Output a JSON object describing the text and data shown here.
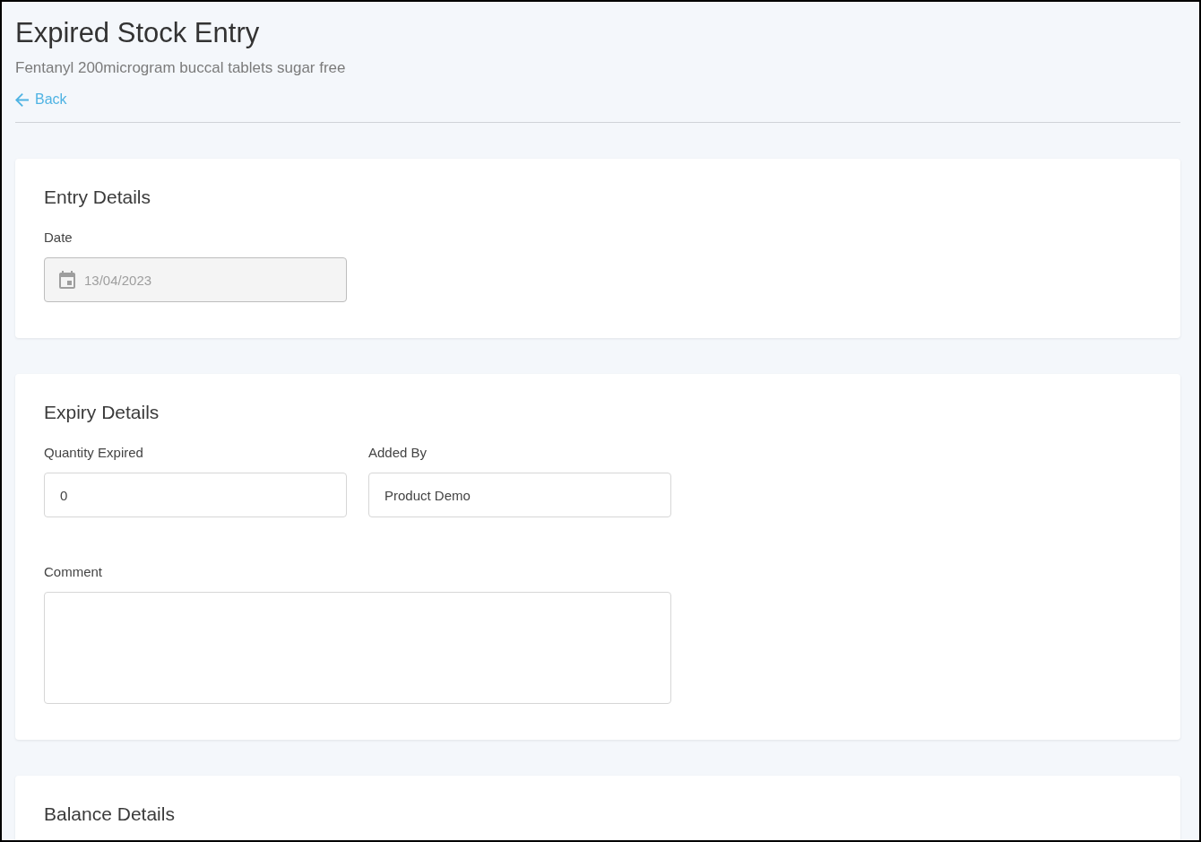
{
  "page": {
    "title": "Expired Stock Entry",
    "subtitle": "Fentanyl 200microgram buccal tablets sugar free",
    "back_link": {
      "label": "Back"
    }
  },
  "sections": [
    {
      "title": "Entry Details",
      "fields": [
        {
          "kind": "date",
          "label": "Date",
          "value": "13/04/2023",
          "disabled": true
        }
      ]
    },
    {
      "title": "Expiry Details",
      "fields": [
        {
          "kind": "text",
          "label": "Quantity Expired",
          "value": "0",
          "disabled": false
        },
        {
          "kind": "text",
          "label": "Added By",
          "value": "Product Demo",
          "disabled": false
        },
        {
          "kind": "textarea",
          "label": "Comment",
          "disabled": false
        }
      ]
    },
    {
      "title": "Balance Details"
    }
  ]
}
